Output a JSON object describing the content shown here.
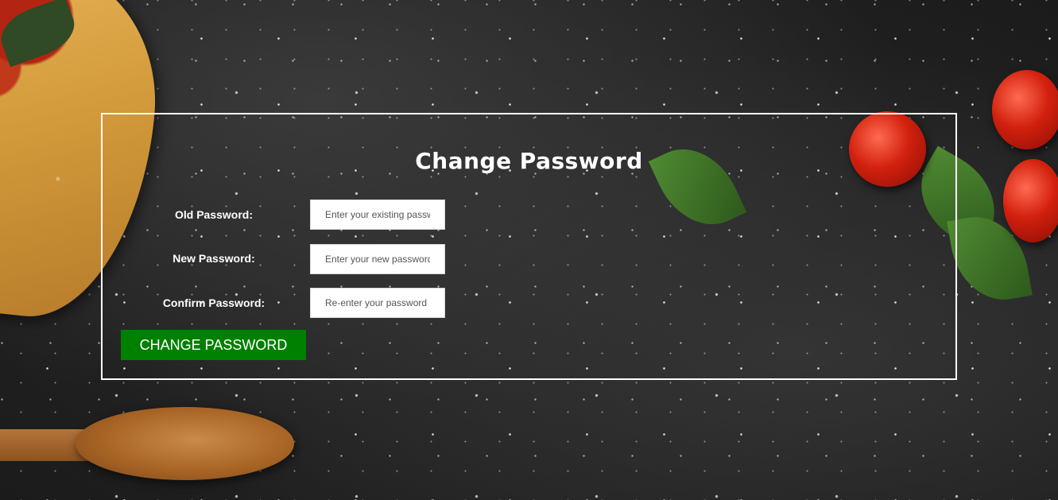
{
  "form": {
    "title": "Change Password",
    "fields": [
      {
        "label": "Old Password:",
        "placeholder": "Enter your existing password",
        "value": ""
      },
      {
        "label": "New Password:",
        "placeholder": "Enter your new password",
        "value": ""
      },
      {
        "label": "Confirm Password:",
        "placeholder": "Re-enter your password",
        "value": ""
      }
    ],
    "submit_label": "CHANGE PASSWORD"
  },
  "colors": {
    "button": "#008000",
    "panel_border": "#ffffff",
    "background": "#222222"
  }
}
